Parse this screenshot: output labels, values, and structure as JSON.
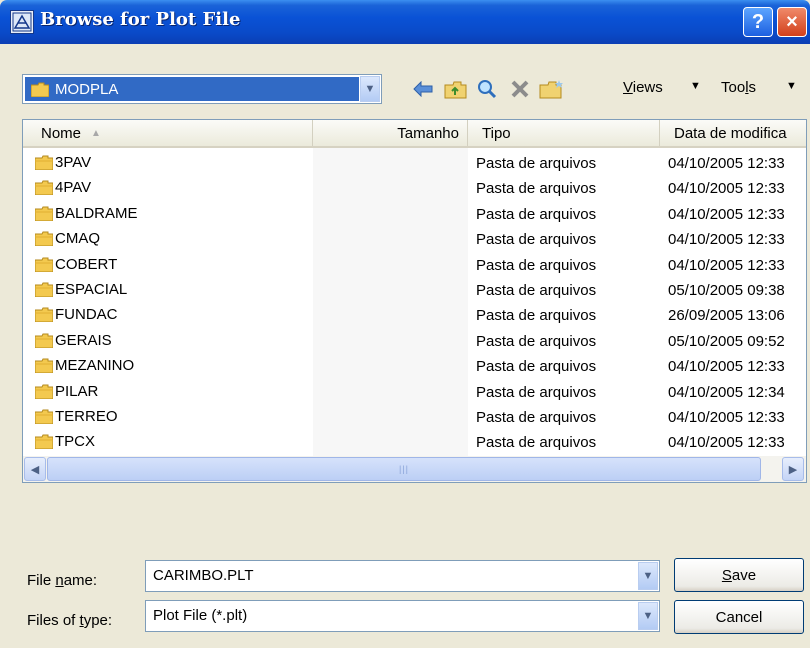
{
  "window": {
    "title": "Browse for Plot File",
    "help_label": "?",
    "close_label": "×"
  },
  "toolbar": {
    "look_in_value": "MODPLA",
    "views_menu": {
      "label_pre": "",
      "label_accel": "V",
      "label_post": "iews"
    },
    "tools_menu": {
      "label_pre": "Too",
      "label_accel": "l",
      "label_post": "s"
    },
    "icons": [
      "back-arrow-icon",
      "up-folder-icon",
      "search-web-icon",
      "delete-icon",
      "new-folder-icon"
    ]
  },
  "list": {
    "columns": {
      "name": "Nome",
      "size": "Tamanho",
      "type": "Tipo",
      "date": "Data de modifica"
    },
    "rows": [
      {
        "name": "3PAV",
        "type": "Pasta de arquivos",
        "date": "04/10/2005 12:33"
      },
      {
        "name": "4PAV",
        "type": "Pasta de arquivos",
        "date": "04/10/2005 12:33"
      },
      {
        "name": "BALDRAME",
        "type": "Pasta de arquivos",
        "date": "04/10/2005 12:33"
      },
      {
        "name": "CMAQ",
        "type": "Pasta de arquivos",
        "date": "04/10/2005 12:33"
      },
      {
        "name": "COBERT",
        "type": "Pasta de arquivos",
        "date": "04/10/2005 12:33"
      },
      {
        "name": "ESPACIAL",
        "type": "Pasta de arquivos",
        "date": "05/10/2005 09:38"
      },
      {
        "name": "FUNDAC",
        "type": "Pasta de arquivos",
        "date": "26/09/2005 13:06"
      },
      {
        "name": "GERAIS",
        "type": "Pasta de arquivos",
        "date": "05/10/2005 09:52"
      },
      {
        "name": "MEZANINO",
        "type": "Pasta de arquivos",
        "date": "04/10/2005 12:33"
      },
      {
        "name": "PILAR",
        "type": "Pasta de arquivos",
        "date": "04/10/2005 12:34"
      },
      {
        "name": "TERREO",
        "type": "Pasta de arquivos",
        "date": "04/10/2005 12:33"
      },
      {
        "name": "TPCX",
        "type": "Pasta de arquivos",
        "date": "04/10/2005 12:33"
      }
    ]
  },
  "form": {
    "file_name_label": {
      "pre": "File ",
      "accel": "n",
      "post": "ame:"
    },
    "file_name_value": "CARIMBO.PLT",
    "file_type_label": {
      "pre": "Files of ",
      "accel": "t",
      "post": "ype:"
    },
    "file_type_value": "Plot File (*.plt)",
    "save_button": {
      "pre": "",
      "accel": "S",
      "post": "ave"
    },
    "cancel_button": "Cancel"
  },
  "colors": {
    "title_bar": "#0a52d6",
    "selection": "#316ac5",
    "folder": "#f3c94f",
    "dialog_bg": "#ece9d8"
  }
}
